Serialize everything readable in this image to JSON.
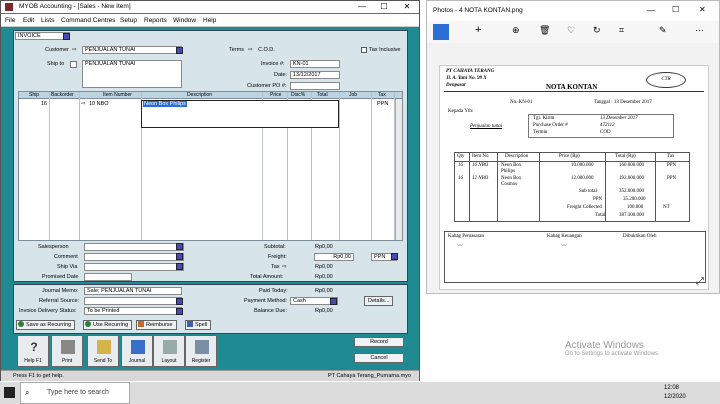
{
  "myob": {
    "title": "MYOB Accounting - [Sales - New Item]",
    "minimize": "—",
    "maximize": "☐",
    "close": "✕",
    "menu": [
      "File",
      "Edit",
      "Lists",
      "Command Centres",
      "Setup",
      "Reports",
      "Window",
      "Help"
    ],
    "sale_type": "INVOICE",
    "customer_label": "Customer",
    "customer_value": "PENJUALAN TUNAI",
    "terms_label": "Terms",
    "terms_value": "C.O.D.",
    "tax_inclusive_label": "Tax Inclusive",
    "ship_to_label": "Ship to",
    "ship_to_value": "PENJUALAN TUNAI",
    "invoice_label": "Invoice #:",
    "invoice_value": "KN-01",
    "date_label": "Date:",
    "date_value": "13/12/2017",
    "customer_po_label": "Customer PO #:",
    "customer_po_value": "",
    "grid_headers": [
      "Ship",
      "Backorder",
      "Item Number",
      "Description",
      "Price",
      "Disc%",
      "Total",
      "Job",
      "Tax"
    ],
    "grid_row": {
      "ship": "16",
      "item": "10 NBO",
      "description": "Neon Box Philips",
      "tax": "PPN"
    },
    "salesperson_label": "Salesperson",
    "comment_label": "Comment",
    "ship_via_label": "Ship Via",
    "promised_date_label": "Promised Date",
    "subtotal_label": "Subtotal:",
    "subtotal_value": "Rp0,00",
    "freight_label": "Freight:",
    "freight_value": "Rp0,00",
    "freight_tax": "PPN",
    "tax_label": "Tax",
    "tax_value": "Rp0,00",
    "total_amount_label": "Total Amount:",
    "total_amount_value": "Rp0,00",
    "journal_memo_label": "Journal Memo:",
    "journal_memo_value": "Sale; PENJUALAN TUNAI",
    "referral_label": "Referral Source:",
    "delivery_status_label": "Invoice Delivery Status:",
    "delivery_status_value": "To be Printed",
    "paid_today_label": "Paid Today:",
    "paid_today_value": "Rp0,00",
    "payment_method_label": "Payment Method:",
    "payment_method_value": "Cash",
    "balance_due_label": "Balance Due:",
    "balance_due_value": "Rp0,00",
    "details_button": "Details...",
    "save_recurring": "Save as Recurring",
    "use_recurring": "Use Recurring",
    "reimburse": "Reimburse",
    "spell": "Spell",
    "toolbar": [
      "Help F1",
      "Print",
      "Send To",
      "Journal",
      "Layout",
      "Register"
    ],
    "record_button": "Record",
    "cancel_button": "Cancel",
    "status_left": "Press F1 to get help.",
    "status_right": "PT Cahaya Terang_Purnama.myo"
  },
  "photos": {
    "title": "Photos - 4 NOTA KONTAN.png",
    "receipt": {
      "company": "PT CAHAYA TERANG",
      "address": "Jl. A. Yani No. 99 X",
      "city": "Denpasar",
      "doc_title": "NOTA KONTAN",
      "stamp": "CTR",
      "no_label": "No. KN-01",
      "date_line": "Tanggal : 13 Desember 2017",
      "kepada": "Kepada Yth:",
      "customer": "Penjualan tunai",
      "tgl_kirim_label": "Tgl. Kirim",
      "tgl_kirim_value": "13 Desember 2017",
      "po_label": "Purchase Order #",
      "po_value": "473112",
      "termin_label": "Termin",
      "termin_value": "COD",
      "headers": [
        "Qty",
        "Item No",
        "Description",
        "Price (Rp)",
        "Total (Rp)",
        "Tax"
      ],
      "rows": [
        {
          "qty": "16",
          "item": "16 NBO",
          "desc1": "Neon Box",
          "desc2": "Philips",
          "price": "10.000.000",
          "total": "160.000.000",
          "tax": "PPN"
        },
        {
          "qty": "16",
          "item": "12 NBO",
          "desc1": "Neon Box",
          "desc2": "Cosmos",
          "price": "12.000.000",
          "total": "192.000.000",
          "tax": "PPN"
        }
      ],
      "subtotal_label": "Sub total",
      "subtotal_value": "352.000.000",
      "ppn_label": "PPN",
      "ppn_value": "35.200.000",
      "freight_label": "Freight Collected",
      "freight_value": "100.000",
      "freight_tax": "NT",
      "total_label": "Total",
      "total_value": "387.300.000",
      "sign1": "Kabag Pemasaran",
      "sign2": "Kabag Keuangan",
      "sign3": "Dibuktikan Oleh"
    }
  },
  "desktop": {
    "activate_line1": "Activate Windows",
    "activate_line2": "Go to Settings to activate Windows.",
    "search_placeholder": "Type here to search",
    "clock_time": "12:08",
    "clock_date": "12/2020"
  }
}
